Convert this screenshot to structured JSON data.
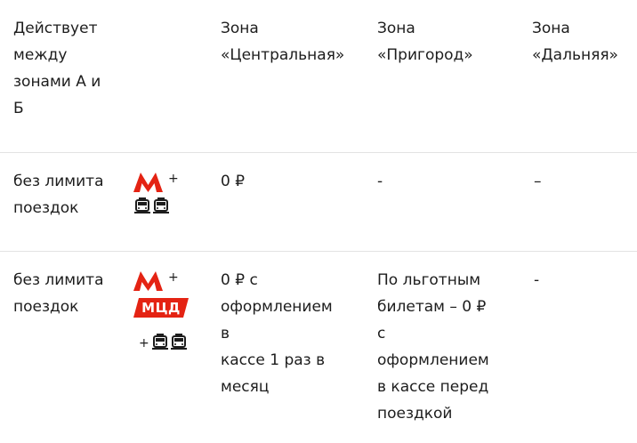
{
  "header": {
    "col1": [
      "Действует",
      "между",
      "зонами А и",
      "Б"
    ],
    "col3": [
      "Зона",
      "«Центральная»"
    ],
    "col4": [
      "Зона",
      "«Пригород»"
    ],
    "col5": [
      "Зона",
      "«Дальняя»"
    ]
  },
  "rows": [
    {
      "col1": [
        "без лимита",
        "поездок"
      ],
      "transport_icons": [
        "metro-icon",
        "plus",
        "tram-icon",
        "tram-icon"
      ],
      "plus_sign": "+",
      "col3": [
        "0 ₽"
      ],
      "col4": "-",
      "col5": "–"
    },
    {
      "col1": [
        "без лимита",
        "поездок"
      ],
      "transport_icons": [
        "metro-icon",
        "plus",
        "mcd-badge",
        "plus",
        "tram-icon",
        "tram-icon"
      ],
      "plus_sign_1": "+",
      "mcd_label": "МЦД",
      "plus_sign_2": "+",
      "col3": [
        "0 ₽ с",
        "оформлением",
        "в",
        "кассе 1 раз в",
        "месяц"
      ],
      "col4": [
        "По льготным",
        "билетам – 0 ₽",
        "с",
        "оформлением",
        "в кассе перед",
        "поездкой"
      ],
      "col5": "-"
    }
  ],
  "colors": {
    "metro_red": "#e42313",
    "mcd_red": "#e42313",
    "divider": "#e3e3e3",
    "text": "#1d1d1d"
  }
}
